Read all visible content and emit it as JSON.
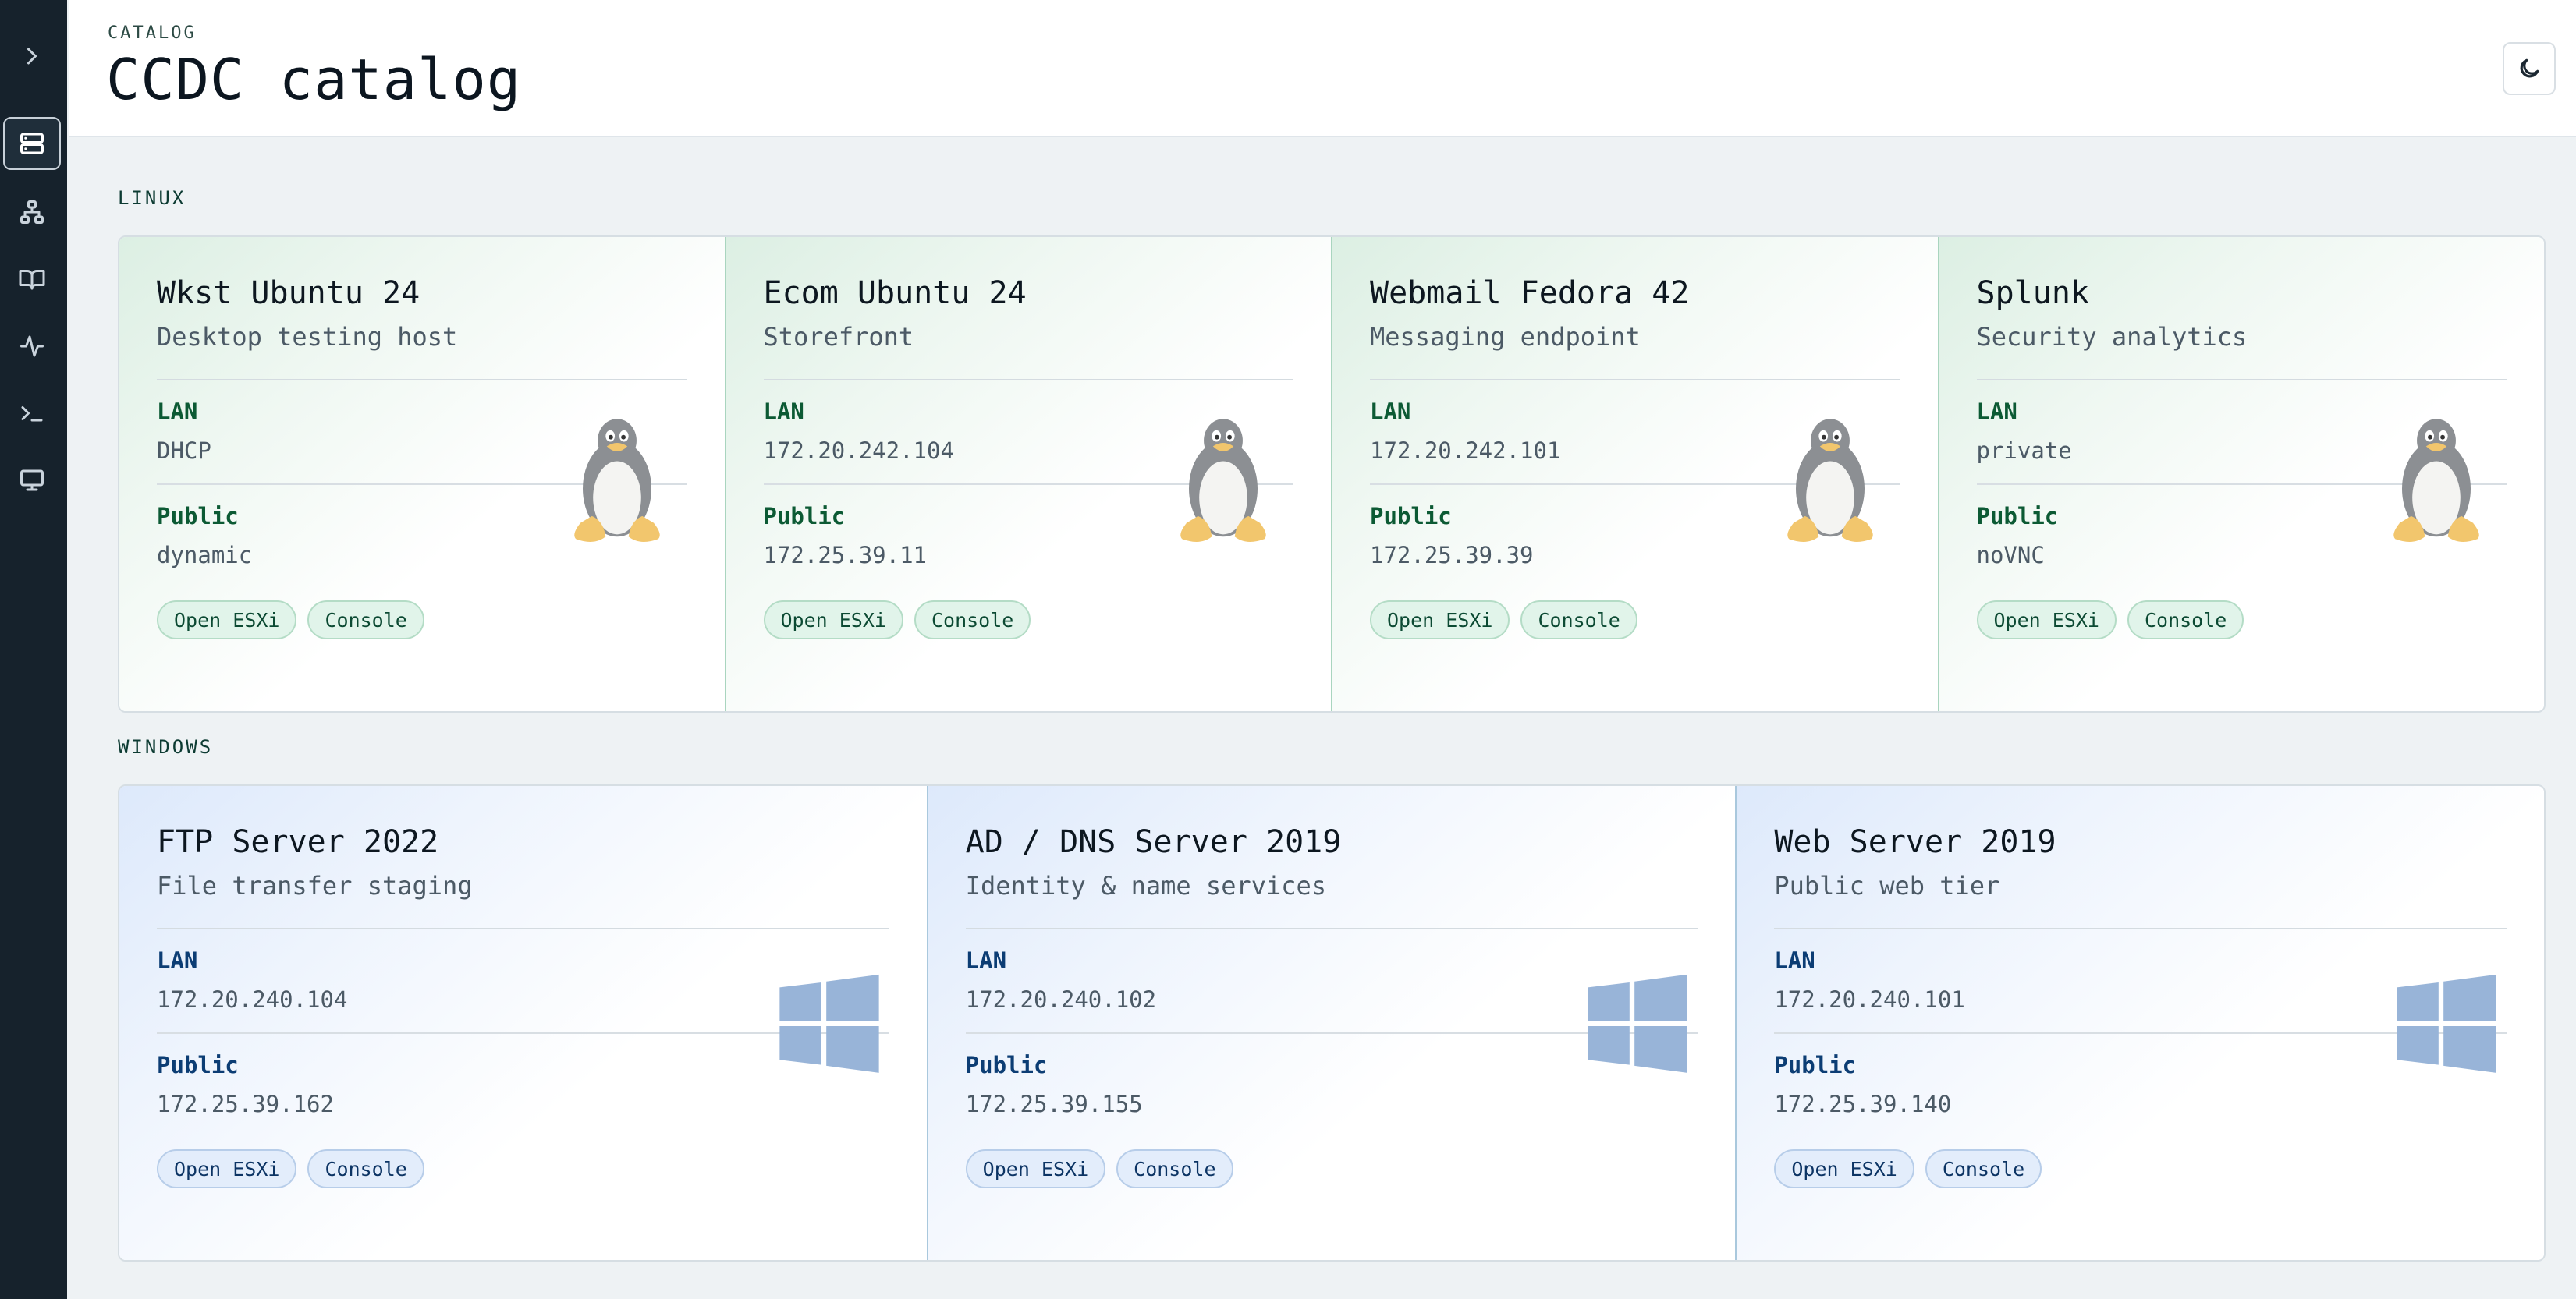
{
  "header": {
    "eyebrow": "CATALOG",
    "title": "CCDC catalog"
  },
  "sidebar": {
    "items": [
      {
        "name": "expand",
        "icon": "chevron-right-icon"
      },
      {
        "name": "catalog",
        "icon": "server-icon",
        "active": true
      },
      {
        "name": "network",
        "icon": "network-icon"
      },
      {
        "name": "docs",
        "icon": "book-icon"
      },
      {
        "name": "activity",
        "icon": "activity-icon"
      },
      {
        "name": "terminal",
        "icon": "terminal-icon"
      },
      {
        "name": "monitor",
        "icon": "monitor-icon"
      }
    ]
  },
  "theme_toggle": {
    "icon": "moon-icon"
  },
  "sections": {
    "linux": {
      "label": "LINUX",
      "icon": "linux-penguin-icon",
      "cards": [
        {
          "title": "Wkst Ubuntu 24",
          "subtitle": "Desktop testing host",
          "lan_label": "LAN",
          "lan": "DHCP",
          "public_label": "Public",
          "public": "dynamic",
          "buttons": [
            "Open ESXi",
            "Console"
          ]
        },
        {
          "title": "Ecom Ubuntu 24",
          "subtitle": "Storefront",
          "lan_label": "LAN",
          "lan": "172.20.242.104",
          "public_label": "Public",
          "public": "172.25.39.11",
          "buttons": [
            "Open ESXi",
            "Console"
          ]
        },
        {
          "title": "Webmail Fedora 42",
          "subtitle": "Messaging endpoint",
          "lan_label": "LAN",
          "lan": "172.20.242.101",
          "public_label": "Public",
          "public": "172.25.39.39",
          "buttons": [
            "Open ESXi",
            "Console"
          ]
        },
        {
          "title": "Splunk",
          "subtitle": "Security analytics",
          "lan_label": "LAN",
          "lan": "private",
          "public_label": "Public",
          "public": "noVNC",
          "buttons": [
            "Open ESXi",
            "Console"
          ]
        }
      ]
    },
    "windows": {
      "label": "WINDOWS",
      "icon": "windows-logo-icon",
      "cards": [
        {
          "title": "FTP Server 2022",
          "subtitle": "File transfer staging",
          "lan_label": "LAN",
          "lan": "172.20.240.104",
          "public_label": "Public",
          "public": "172.25.39.162",
          "buttons": [
            "Open ESXi",
            "Console"
          ]
        },
        {
          "title": "AD / DNS Server 2019",
          "subtitle": "Identity & name services",
          "lan_label": "LAN",
          "lan": "172.20.240.102",
          "public_label": "Public",
          "public": "172.25.39.155",
          "buttons": [
            "Open ESXi",
            "Console"
          ]
        },
        {
          "title": "Web Server 2019",
          "subtitle": "Public web tier",
          "lan_label": "LAN",
          "lan": "172.20.240.101",
          "public_label": "Public",
          "public": "172.25.39.140",
          "buttons": [
            "Open ESXi",
            "Console"
          ]
        }
      ]
    }
  },
  "colors": {
    "sidebar": "#16222c",
    "linux_accent": "#0c5a34",
    "windows_accent": "#0c3d74",
    "background": "#eef2f4"
  }
}
